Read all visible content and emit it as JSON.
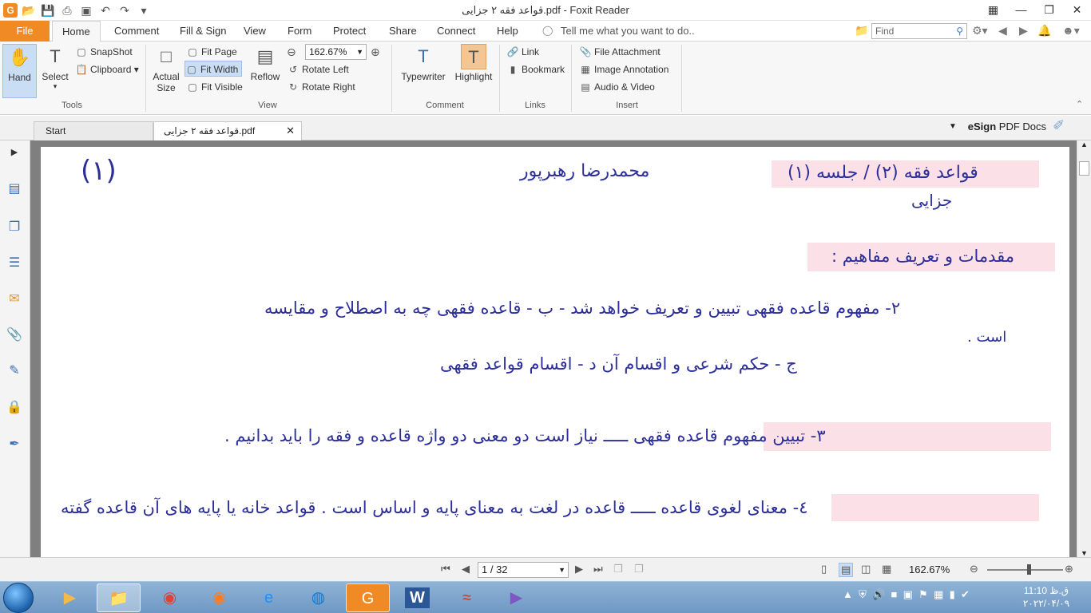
{
  "window": {
    "title": "قواعد فقه ۲ جزایی.pdf - Foxit Reader",
    "qat_icons": [
      "foxit-logo-icon",
      "open-icon",
      "save-icon",
      "print-icon",
      "window-icon",
      "undo-icon",
      "redo-icon",
      "customize-icon"
    ]
  },
  "menu": {
    "file": "File",
    "tabs": [
      "Home",
      "Comment",
      "Fill & Sign",
      "View",
      "Form",
      "Protect",
      "Share",
      "Connect",
      "Help"
    ],
    "tell_me": "Tell me what you want to do..",
    "find_placeholder": "Find"
  },
  "ribbon": {
    "tools": {
      "hand": "Hand",
      "select": "Select",
      "snapshot": "SnapShot",
      "clipboard": "Clipboard",
      "label": "Tools"
    },
    "view": {
      "actual_size_1": "Actual",
      "actual_size_2": "Size",
      "fit_page": "Fit Page",
      "fit_width": "Fit Width",
      "fit_visible": "Fit Visible",
      "reflow": "Reflow",
      "zoom": "162.67%",
      "rotate_left": "Rotate Left",
      "rotate_right": "Rotate Right",
      "label": "View"
    },
    "comment": {
      "typewriter": "Typewriter",
      "highlight": "Highlight",
      "label": "Comment"
    },
    "links": {
      "link": "Link",
      "bookmark": "Bookmark",
      "label": "Links"
    },
    "insert": {
      "file_attachment": "File Attachment",
      "image_annotation": "Image Annotation",
      "audio_video": "Audio & Video",
      "label": "Insert"
    }
  },
  "doc_tabs": {
    "start": "Start",
    "active": "قواعد فقه ۲ جزایی.pdf",
    "esign_bold": "eSign",
    "esign_rest": " PDF Docs"
  },
  "page_content": {
    "page_number_mark": "(۱)",
    "author": "محمدرضا رهبرپور",
    "header_title": "قواعد فقه (۲) / جلسه (۱)",
    "header_subtitle": "جزایی",
    "section_title": "مقدمات و تعریف مفاهیم :",
    "line2": "۲- مفهوم قاعده فقهی تبیین و تعریف خواهد شد - ب - قاعده فقهی چه به اصطلاح و مقایسه",
    "line2b": "است .",
    "line2c": "ج - حکم شرعی و اقسام آن     د - اقسام قواعد فقهی",
    "line3": "۳- تبیین مفهوم قاعده فقهی ـــــ نیاز است دو معنی دو واژه قاعده و فقه را باید بدانیم .",
    "line4": "٤- معنای لغوی قاعده ـــــ قاعده در لغت به معنای پایه و اساس است . قواعد خانه یا پایه های آن قاعده گفته"
  },
  "status": {
    "page_indicator": "1 / 32",
    "zoom": "162.67%"
  },
  "taskbar": {
    "apps": [
      "media-player-icon",
      "file-explorer-icon",
      "chrome-icon",
      "firefox-icon",
      "ie-icon",
      "edge-icon",
      "foxit-icon",
      "word-icon",
      "app-icon",
      "visual-studio-icon"
    ],
    "time": "11:10 ق.ظ",
    "date": "۲۰۲۲/۰۴/۰۹"
  }
}
